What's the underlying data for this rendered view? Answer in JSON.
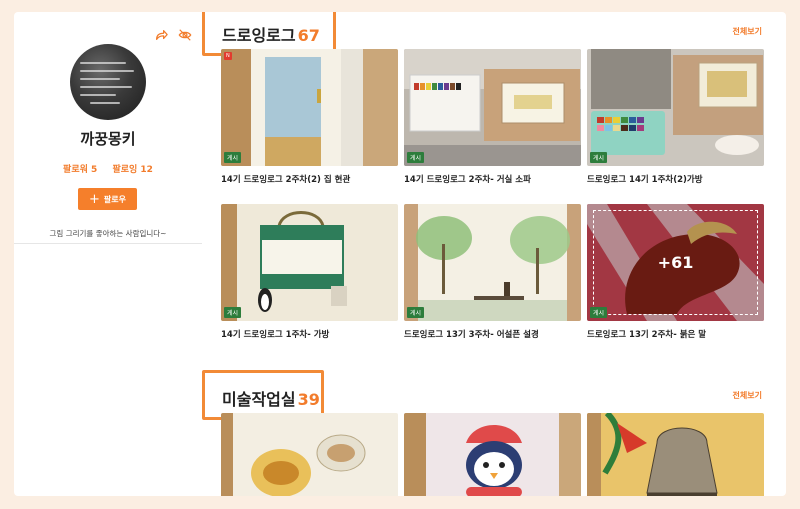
{
  "profile": {
    "nickname": "까꿍몽키",
    "followers_label": "팔로워 5",
    "following_label": "팔로잉 12",
    "follow_button_label": "팔로우",
    "bio": "그림 그리기를 좋아하는 사람입니다~",
    "icons": [
      "share-icon",
      "hide-icon"
    ]
  },
  "sections": [
    {
      "title": "드로잉로그",
      "count": "67",
      "see_all_label": "전체보기",
      "items": [
        {
          "caption": "14기 드로잉로그 2주차(2) 집 현관",
          "badge": "게시",
          "new_badge": "N"
        },
        {
          "caption": "14기 드로잉로그 2주차- 거실 소파",
          "badge": "게시"
        },
        {
          "caption": "드로잉로그 14기 1주차(2)가방",
          "badge": "게시"
        },
        {
          "caption": "14기 드로잉로그 1주차- 가방",
          "badge": "게시"
        },
        {
          "caption": "드로잉로그 13기 3주차- 어설픈 설경",
          "badge": "게시"
        },
        {
          "caption": "드로잉로그 13기 2주차- 붉은 말",
          "badge": "게시",
          "more_label": "+61"
        }
      ]
    },
    {
      "title": "미술작업실",
      "count": "39",
      "see_all_label": "전체보기",
      "items": [
        {},
        {},
        {}
      ]
    }
  ],
  "colors": {
    "accent": "#f27c2c",
    "highlight": "#f28a36",
    "badge": "#2d7d3c",
    "background": "#fbeee2"
  }
}
